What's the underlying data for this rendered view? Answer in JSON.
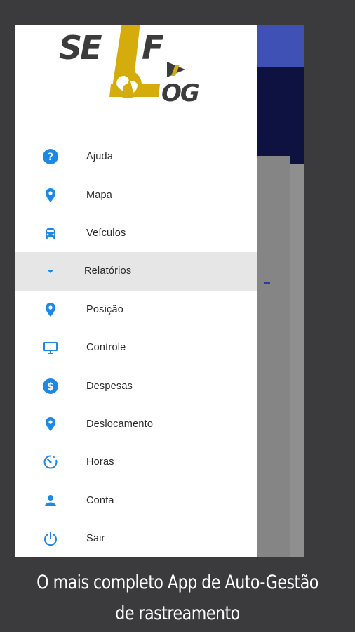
{
  "brand": {
    "logo_text_top": "SELF",
    "logo_text_bottom": "LOG"
  },
  "colors": {
    "icon_blue": "#1e88e5",
    "logo_gold": "#d4ac0d",
    "logo_dark": "#3c3c3c",
    "active_row": "#e6e6e6"
  },
  "menu": {
    "items": [
      {
        "label": "Ajuda",
        "icon": "help-circle-icon"
      },
      {
        "label": "Mapa",
        "icon": "map-pin-icon"
      },
      {
        "label": "Veículos",
        "icon": "car-icon"
      },
      {
        "label": "Relatórios",
        "icon": "caret-down-icon",
        "expanded": true
      },
      {
        "label": "Posição",
        "icon": "map-pin-icon"
      },
      {
        "label": "Controle",
        "icon": "monitor-icon"
      },
      {
        "label": "Despesas",
        "icon": "dollar-circle-icon"
      },
      {
        "label": "Deslocamento",
        "icon": "map-pin-icon"
      },
      {
        "label": "Horas",
        "icon": "timer-icon"
      },
      {
        "label": "Conta",
        "icon": "person-icon"
      },
      {
        "label": "Sair",
        "icon": "power-icon"
      }
    ]
  },
  "caption": {
    "line1": "O mais completo App de Auto-Gestão",
    "line2": "de rastreamento"
  }
}
